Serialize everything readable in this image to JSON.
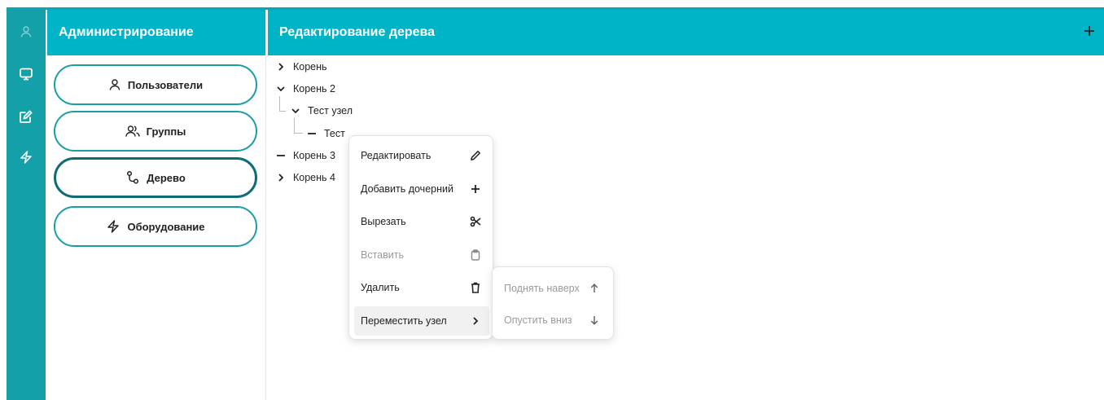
{
  "sidebar_panel": {
    "title": "Администрирование",
    "items": [
      {
        "label": "Пользователи",
        "icon": "user-icon",
        "active": false
      },
      {
        "label": "Группы",
        "icon": "users-icon",
        "active": false
      },
      {
        "label": "Дерево",
        "icon": "tree-icon",
        "active": true
      },
      {
        "label": "Оборудование",
        "icon": "bolt-icon",
        "active": false
      }
    ]
  },
  "rail": {
    "icons": [
      "user-icon",
      "monitor-icon",
      "edit-icon",
      "bolt-icon"
    ]
  },
  "tree_panel": {
    "title": "Редактирование дерева",
    "add_icon": "plus-icon",
    "nodes": [
      {
        "label": "Корень",
        "state": "collapsed"
      },
      {
        "label": "Корень 2",
        "state": "expanded"
      },
      {
        "label": "Тест узел",
        "state": "expanded"
      },
      {
        "label": "Тест",
        "state": "leaf"
      },
      {
        "label": "Корень 3",
        "state": "leaf"
      },
      {
        "label": "Корень 4",
        "state": "collapsed"
      }
    ]
  },
  "context_menu": {
    "items": [
      {
        "label": "Редактировать",
        "icon": "pencil-icon",
        "disabled": false
      },
      {
        "label": "Добавить дочерний",
        "icon": "plus-icon",
        "disabled": false
      },
      {
        "label": "Вырезать",
        "icon": "scissors-icon",
        "disabled": false
      },
      {
        "label": "Вставить",
        "icon": "clipboard-icon",
        "disabled": true
      },
      {
        "label": "Удалить",
        "icon": "trash-icon",
        "disabled": false
      },
      {
        "label": "Переместить узел",
        "icon": "chevron-right-icon",
        "disabled": false,
        "highlighted": true
      }
    ]
  },
  "submenu": {
    "items": [
      {
        "label": "Поднять наверх",
        "icon": "arrow-up-icon",
        "disabled": true
      },
      {
        "label": "Опустить вниз",
        "icon": "arrow-down-icon",
        "disabled": true
      }
    ]
  },
  "colors": {
    "accent": "#00b4c8",
    "rail": "#14a0a8",
    "button_border": "#1a9ea6",
    "active_border": "#0f6c74"
  }
}
